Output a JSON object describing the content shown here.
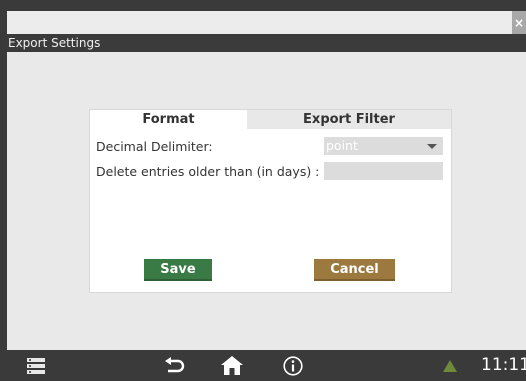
{
  "window": {
    "title": "Export Settings",
    "close_symbol": "×"
  },
  "tabs": [
    {
      "label": "Format",
      "active": true
    },
    {
      "label": "Export Filter",
      "active": false
    }
  ],
  "form": {
    "decimal_delimiter_label": "Decimal Delimiter:",
    "decimal_delimiter_value": "point",
    "delete_entries_label": "Delete entries older than (in days) :",
    "delete_entries_value": ""
  },
  "buttons": {
    "save": "Save",
    "cancel": "Cancel"
  },
  "navbar": {
    "icons": [
      "menu-icon",
      "back-icon",
      "home-icon",
      "info-icon",
      "warning-icon"
    ],
    "time": "11:11"
  },
  "colors": {
    "save": "#3a7a45",
    "cancel": "#9c7a3f",
    "warning": "#6f8a3a"
  }
}
